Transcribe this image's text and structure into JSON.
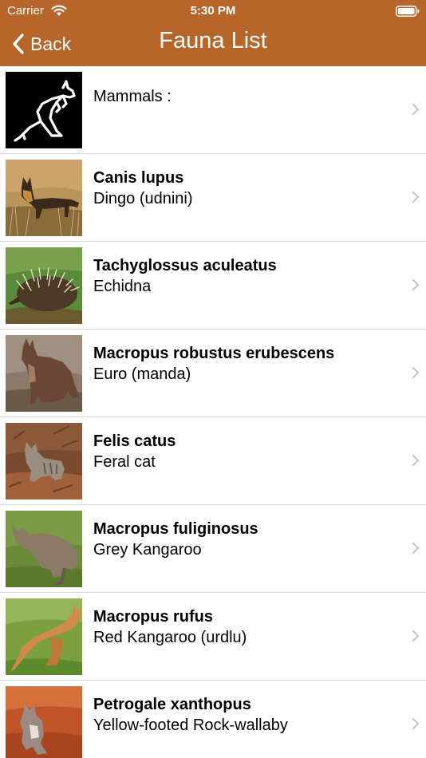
{
  "status_bar": {
    "carrier": "Carrier",
    "time": "5:30 PM",
    "wifi_icon": "wifi-icon",
    "battery_icon": "battery-icon"
  },
  "nav": {
    "back_label": "Back",
    "title": "Fauna List",
    "color": "#B6662A"
  },
  "list": {
    "header": {
      "label": "Mammals :",
      "icon": "kangaroo-outline-icon"
    },
    "items": [
      {
        "scientific_name": "Canis lupus",
        "common_name": "Dingo (udnini)",
        "photo": "dingo-photo"
      },
      {
        "scientific_name": "Tachyglossus aculeatus",
        "common_name": "Echidna",
        "photo": "echidna-photo"
      },
      {
        "scientific_name": "Macropus robustus erubescens",
        "common_name": "Euro (manda)",
        "photo": "euro-photo"
      },
      {
        "scientific_name": "Felis catus",
        "common_name": "Feral cat",
        "photo": "feral-cat-photo"
      },
      {
        "scientific_name": "Macropus fuliginosus",
        "common_name": "Grey Kangaroo",
        "photo": "grey-kangaroo-photo"
      },
      {
        "scientific_name": "Macropus rufus",
        "common_name": "Red Kangaroo (urdlu)",
        "photo": "red-kangaroo-photo"
      },
      {
        "scientific_name": "Petrogale xanthopus",
        "common_name": "Yellow-footed Rock-wallaby",
        "photo": "rock-wallaby-photo"
      }
    ]
  }
}
